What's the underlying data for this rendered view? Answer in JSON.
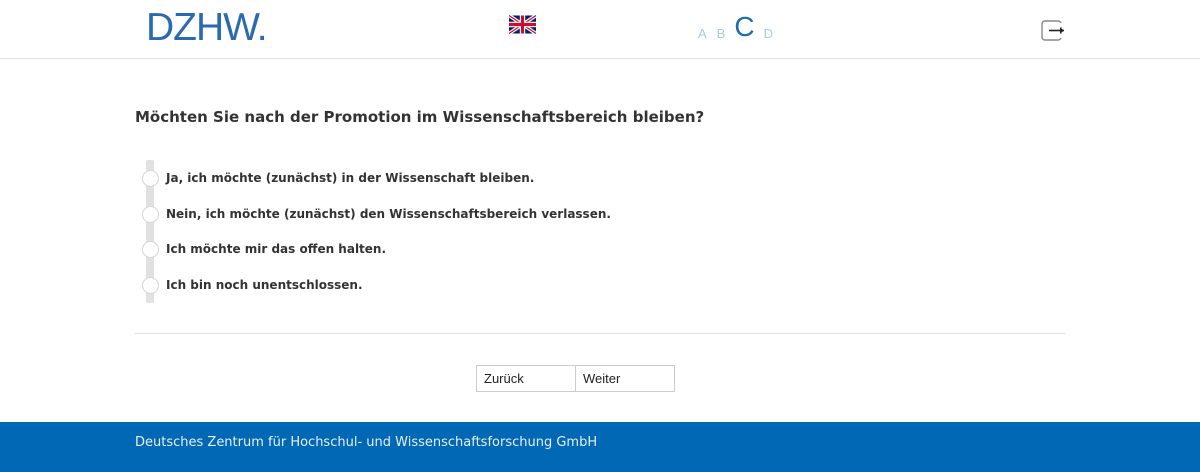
{
  "header": {
    "logo_text": "DZHW.",
    "flag_icon": "uk-flag-icon",
    "font_sizes": [
      "A",
      "B",
      "C",
      "D"
    ],
    "active_font_size": "C",
    "logout_icon": "logout-icon"
  },
  "question": {
    "text": "Möchten Sie nach der Promotion im Wissenschaftsbereich bleiben?",
    "options": [
      "Ja, ich möchte (zunächst) in der Wissenschaft bleiben.",
      "Nein, ich möchte (zunächst) den Wissenschaftsbereich verlassen.",
      "Ich möchte mir das offen halten.",
      "Ich bin noch unentschlossen."
    ]
  },
  "navigation": {
    "back_label": "Zurück",
    "next_label": "Weiter"
  },
  "footer": {
    "text": "Deutsches Zentrum für Hochschul- und Wissenschaftsforschung GmbH"
  },
  "colors": {
    "brand_blue": "#2a6ab1",
    "footer_blue": "#0068b4",
    "font_size_inactive": "#a8cbe7"
  }
}
